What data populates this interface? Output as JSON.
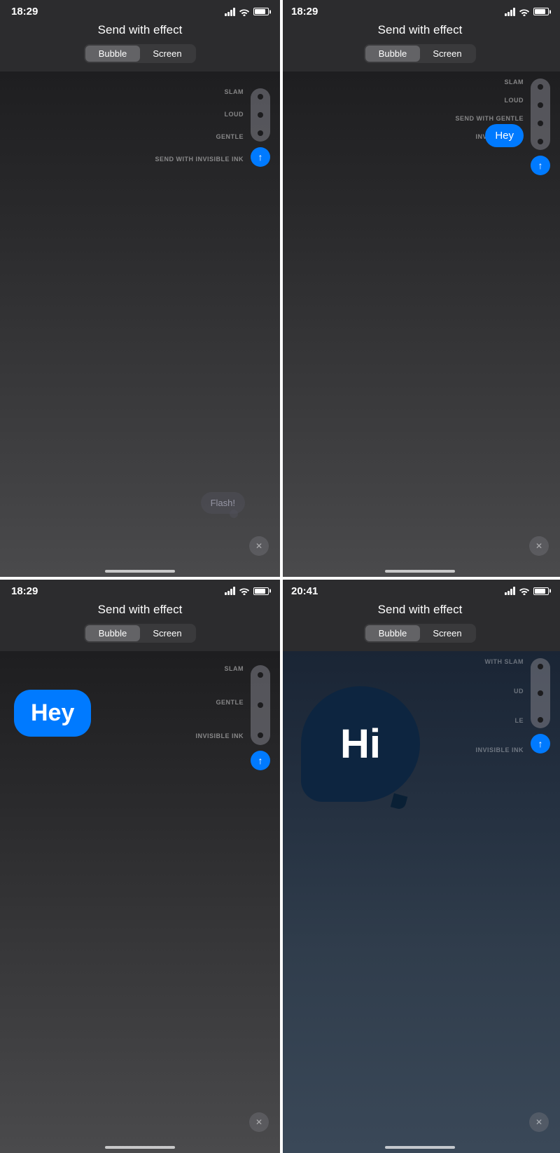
{
  "panels": [
    {
      "id": "top-left",
      "time": "18:29",
      "title": "Send with effect",
      "bubble_label": "Bubble",
      "screen_label": "Screen",
      "active_tab": "bubble",
      "effects": [
        "SLAM",
        "LOUD",
        "GENTLE",
        "SEND WITH INVISIBLE INK"
      ],
      "message": "Flash!",
      "message_type": "invisible",
      "close": "✕"
    },
    {
      "id": "top-right",
      "time": "18:29",
      "title": "Send with effect",
      "bubble_label": "Bubble",
      "screen_label": "Screen",
      "active_tab": "bubble",
      "effects": [
        "SLAM",
        "LOUD",
        "SEND WITH GENTLE",
        "INVISIBLE INK"
      ],
      "message": "Hey",
      "message_type": "normal",
      "close": "✕"
    },
    {
      "id": "bottom-left",
      "time": "18:29",
      "title": "Send with effect",
      "bubble_label": "Bubble",
      "screen_label": "Screen",
      "active_tab": "bubble",
      "effects": [
        "SLAM",
        "GENTLE",
        "INVISIBLE INK"
      ],
      "message": "Hey",
      "message_type": "large",
      "close": "✕"
    },
    {
      "id": "bottom-right",
      "time": "20:41",
      "title": "Send with effect",
      "bubble_label": "Bubble",
      "screen_label": "Screen",
      "active_tab": "bubble",
      "effects": [
        "WITH SLAM",
        "UD",
        "LE",
        "INVISIBLE INK"
      ],
      "message": "Hi",
      "message_type": "hi",
      "close": "✕"
    }
  ],
  "icons": {
    "location": "▲",
    "arrow_up": "↑",
    "close": "✕"
  }
}
